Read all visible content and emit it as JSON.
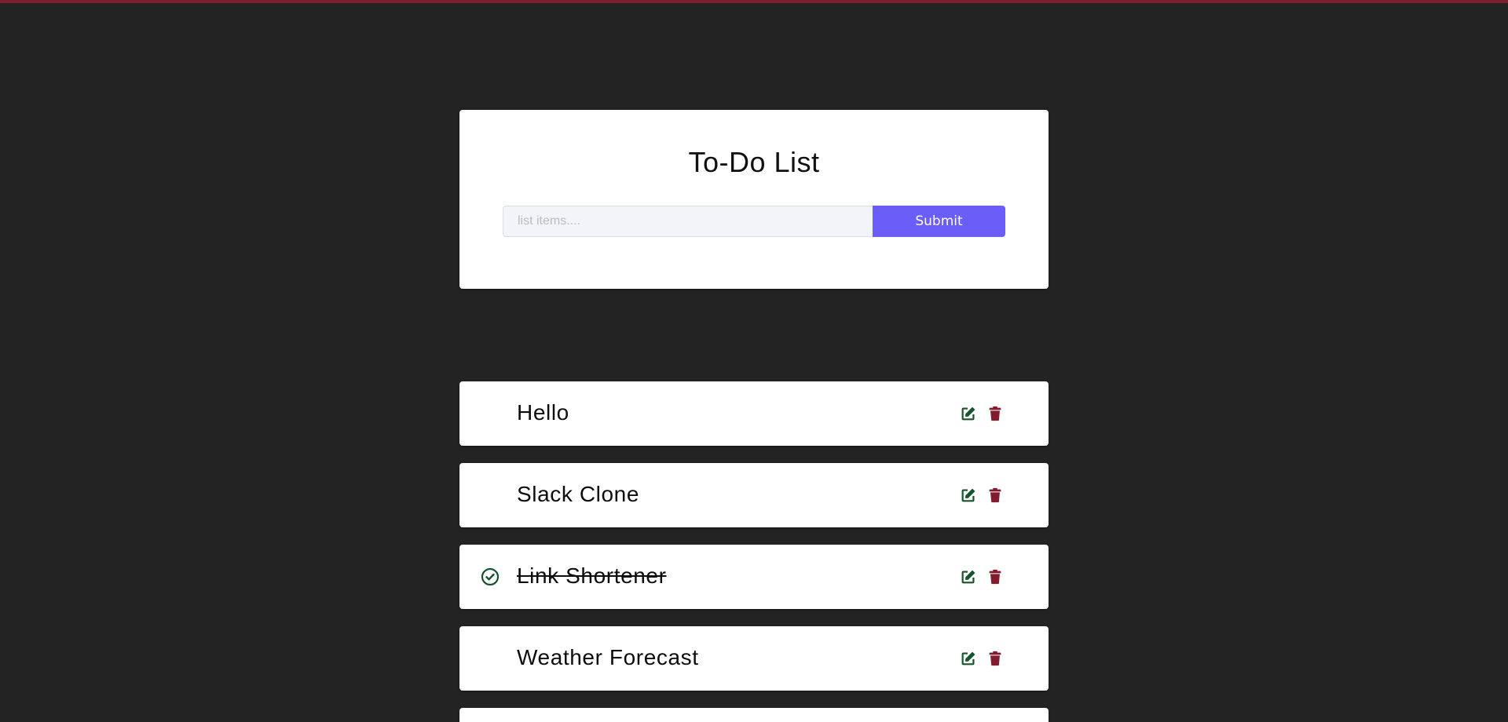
{
  "app": {
    "title": "To-Do List"
  },
  "form": {
    "placeholder": "list items....",
    "value": "",
    "submit_label": "Submit"
  },
  "colors": {
    "background": "#232323",
    "accent": "#6a5df8",
    "edit_icon": "#14532d",
    "delete_icon": "#7f1d2d",
    "check_icon": "#14532d"
  },
  "icons": {
    "edit": "edit-icon",
    "delete": "trash-icon",
    "completed": "check-circle-icon"
  },
  "todos": [
    {
      "label": "Hello",
      "completed": false
    },
    {
      "label": "Slack Clone",
      "completed": false
    },
    {
      "label": "Link Shortener",
      "completed": true
    },
    {
      "label": "Weather Forecast",
      "completed": false
    },
    {
      "label": "",
      "completed": false
    }
  ]
}
